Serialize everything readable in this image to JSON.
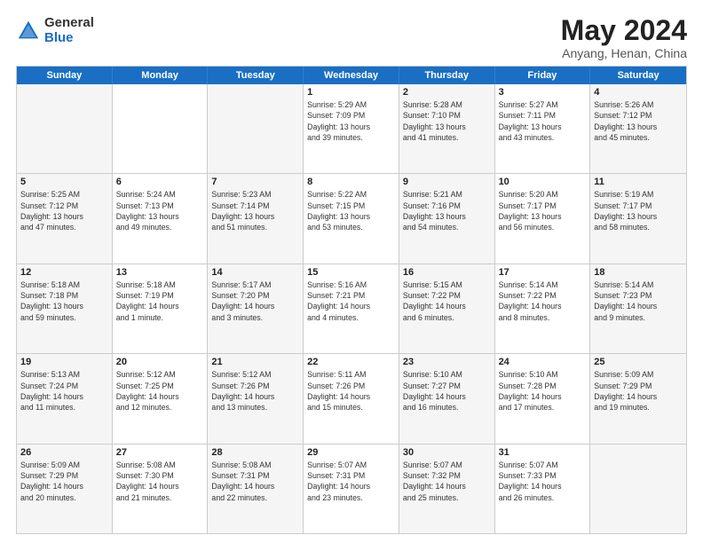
{
  "logo": {
    "general": "General",
    "blue": "Blue"
  },
  "title": "May 2024",
  "location": "Anyang, Henan, China",
  "header_days": [
    "Sunday",
    "Monday",
    "Tuesday",
    "Wednesday",
    "Thursday",
    "Friday",
    "Saturday"
  ],
  "weeks": [
    [
      {
        "day": "",
        "info": ""
      },
      {
        "day": "",
        "info": ""
      },
      {
        "day": "",
        "info": ""
      },
      {
        "day": "1",
        "info": "Sunrise: 5:29 AM\nSunset: 7:09 PM\nDaylight: 13 hours\nand 39 minutes."
      },
      {
        "day": "2",
        "info": "Sunrise: 5:28 AM\nSunset: 7:10 PM\nDaylight: 13 hours\nand 41 minutes."
      },
      {
        "day": "3",
        "info": "Sunrise: 5:27 AM\nSunset: 7:11 PM\nDaylight: 13 hours\nand 43 minutes."
      },
      {
        "day": "4",
        "info": "Sunrise: 5:26 AM\nSunset: 7:12 PM\nDaylight: 13 hours\nand 45 minutes."
      }
    ],
    [
      {
        "day": "5",
        "info": "Sunrise: 5:25 AM\nSunset: 7:12 PM\nDaylight: 13 hours\nand 47 minutes."
      },
      {
        "day": "6",
        "info": "Sunrise: 5:24 AM\nSunset: 7:13 PM\nDaylight: 13 hours\nand 49 minutes."
      },
      {
        "day": "7",
        "info": "Sunrise: 5:23 AM\nSunset: 7:14 PM\nDaylight: 13 hours\nand 51 minutes."
      },
      {
        "day": "8",
        "info": "Sunrise: 5:22 AM\nSunset: 7:15 PM\nDaylight: 13 hours\nand 53 minutes."
      },
      {
        "day": "9",
        "info": "Sunrise: 5:21 AM\nSunset: 7:16 PM\nDaylight: 13 hours\nand 54 minutes."
      },
      {
        "day": "10",
        "info": "Sunrise: 5:20 AM\nSunset: 7:17 PM\nDaylight: 13 hours\nand 56 minutes."
      },
      {
        "day": "11",
        "info": "Sunrise: 5:19 AM\nSunset: 7:17 PM\nDaylight: 13 hours\nand 58 minutes."
      }
    ],
    [
      {
        "day": "12",
        "info": "Sunrise: 5:18 AM\nSunset: 7:18 PM\nDaylight: 13 hours\nand 59 minutes."
      },
      {
        "day": "13",
        "info": "Sunrise: 5:18 AM\nSunset: 7:19 PM\nDaylight: 14 hours\nand 1 minute."
      },
      {
        "day": "14",
        "info": "Sunrise: 5:17 AM\nSunset: 7:20 PM\nDaylight: 14 hours\nand 3 minutes."
      },
      {
        "day": "15",
        "info": "Sunrise: 5:16 AM\nSunset: 7:21 PM\nDaylight: 14 hours\nand 4 minutes."
      },
      {
        "day": "16",
        "info": "Sunrise: 5:15 AM\nSunset: 7:22 PM\nDaylight: 14 hours\nand 6 minutes."
      },
      {
        "day": "17",
        "info": "Sunrise: 5:14 AM\nSunset: 7:22 PM\nDaylight: 14 hours\nand 8 minutes."
      },
      {
        "day": "18",
        "info": "Sunrise: 5:14 AM\nSunset: 7:23 PM\nDaylight: 14 hours\nand 9 minutes."
      }
    ],
    [
      {
        "day": "19",
        "info": "Sunrise: 5:13 AM\nSunset: 7:24 PM\nDaylight: 14 hours\nand 11 minutes."
      },
      {
        "day": "20",
        "info": "Sunrise: 5:12 AM\nSunset: 7:25 PM\nDaylight: 14 hours\nand 12 minutes."
      },
      {
        "day": "21",
        "info": "Sunrise: 5:12 AM\nSunset: 7:26 PM\nDaylight: 14 hours\nand 13 minutes."
      },
      {
        "day": "22",
        "info": "Sunrise: 5:11 AM\nSunset: 7:26 PM\nDaylight: 14 hours\nand 15 minutes."
      },
      {
        "day": "23",
        "info": "Sunrise: 5:10 AM\nSunset: 7:27 PM\nDaylight: 14 hours\nand 16 minutes."
      },
      {
        "day": "24",
        "info": "Sunrise: 5:10 AM\nSunset: 7:28 PM\nDaylight: 14 hours\nand 17 minutes."
      },
      {
        "day": "25",
        "info": "Sunrise: 5:09 AM\nSunset: 7:29 PM\nDaylight: 14 hours\nand 19 minutes."
      }
    ],
    [
      {
        "day": "26",
        "info": "Sunrise: 5:09 AM\nSunset: 7:29 PM\nDaylight: 14 hours\nand 20 minutes."
      },
      {
        "day": "27",
        "info": "Sunrise: 5:08 AM\nSunset: 7:30 PM\nDaylight: 14 hours\nand 21 minutes."
      },
      {
        "day": "28",
        "info": "Sunrise: 5:08 AM\nSunset: 7:31 PM\nDaylight: 14 hours\nand 22 minutes."
      },
      {
        "day": "29",
        "info": "Sunrise: 5:07 AM\nSunset: 7:31 PM\nDaylight: 14 hours\nand 23 minutes."
      },
      {
        "day": "30",
        "info": "Sunrise: 5:07 AM\nSunset: 7:32 PM\nDaylight: 14 hours\nand 25 minutes."
      },
      {
        "day": "31",
        "info": "Sunrise: 5:07 AM\nSunset: 7:33 PM\nDaylight: 14 hours\nand 26 minutes."
      },
      {
        "day": "",
        "info": ""
      }
    ]
  ]
}
